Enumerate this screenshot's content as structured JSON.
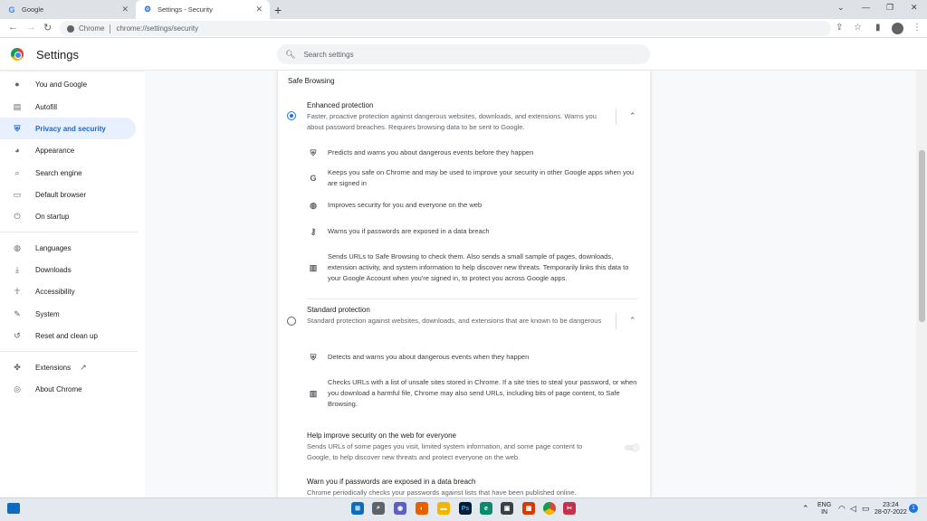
{
  "tabs": [
    {
      "title": "Google",
      "icon": "google-g-icon",
      "active": false
    },
    {
      "title": "Settings - Security",
      "icon": "gear-icon",
      "active": true
    }
  ],
  "toolbar": {
    "omnibox_label": "Chrome",
    "url": "chrome://settings/security"
  },
  "header": {
    "title": "Settings",
    "search_placeholder": "Search settings"
  },
  "sidebar": {
    "items": [
      {
        "label": "You and Google",
        "icon": "person-icon"
      },
      {
        "label": "Autofill",
        "icon": "clipboard-icon"
      },
      {
        "label": "Privacy and security",
        "icon": "shield-icon",
        "active": true
      },
      {
        "label": "Appearance",
        "icon": "palette-icon"
      },
      {
        "label": "Search engine",
        "icon": "search-icon"
      },
      {
        "label": "Default browser",
        "icon": "browser-window-icon"
      },
      {
        "label": "On startup",
        "icon": "power-icon"
      },
      {
        "label": "Languages",
        "icon": "globe-icon"
      },
      {
        "label": "Downloads",
        "icon": "download-icon"
      },
      {
        "label": "Accessibility",
        "icon": "accessibility-icon"
      },
      {
        "label": "System",
        "icon": "wrench-icon"
      },
      {
        "label": "Reset and clean up",
        "icon": "restore-icon"
      },
      {
        "label": "Extensions",
        "icon": "puzzle-icon"
      },
      {
        "label": "About Chrome",
        "icon": "chrome-icon"
      }
    ]
  },
  "main": {
    "section_title": "Safe Browsing",
    "enhanced": {
      "title": "Enhanced protection",
      "desc": "Faster, proactive protection against dangerous websites, downloads, and extensions. Warns you about password breaches. Requires browsing data to be sent to Google.",
      "selected": true,
      "bullets": [
        {
          "icon": "shield-icon",
          "text": "Predicts and warns you about dangerous events before they happen"
        },
        {
          "icon": "google-g-icon",
          "text": "Keeps you safe on Chrome and may be used to improve your security in other Google apps when you are signed in"
        },
        {
          "icon": "globe-icon",
          "text": "Improves security for you and everyone on the web"
        },
        {
          "icon": "key-icon",
          "text": "Warns you if passwords are exposed in a data breach"
        },
        {
          "icon": "bar-chart-icon",
          "text": "Sends URLs to Safe Browsing to check them. Also sends a small sample of pages, downloads, extension activity, and system information to help discover new threats. Temporarily links this data to your Google Account when you're signed in, to protect you across Google apps."
        }
      ]
    },
    "standard": {
      "title": "Standard protection",
      "desc": "Standard protection against websites, downloads, and extensions that are known to be dangerous",
      "selected": false,
      "bullets": [
        {
          "icon": "shield-icon",
          "text": "Detects and warns you about dangerous events when they happen"
        },
        {
          "icon": "bar-chart-icon",
          "text": "Checks URLs with a list of unsafe sites stored in Chrome. If a site tries to steal your password, or when you download a harmful file, Chrome may also send URLs, including bits of page content, to Safe Browsing."
        }
      ]
    },
    "help_improve": {
      "title": "Help improve security on the web for everyone",
      "desc": "Sends URLs of some pages you visit, limited system information, and some page content to Google, to help discover new threats and protect everyone on the web.",
      "enabled": false
    },
    "warn_passwords": {
      "title": "Warn you if passwords are exposed in a data breach",
      "desc": "Chrome periodically checks your passwords against lists that have been published online."
    }
  },
  "taskbar": {
    "lang_line1": "ENG",
    "lang_line2": "IN",
    "time": "23:24",
    "date": "28-07-2022",
    "notification_count": "1"
  },
  "colors": {
    "accent": "#1a73e8",
    "active_nav_bg": "#e8f0fe",
    "active_nav_text": "#1967d2"
  }
}
